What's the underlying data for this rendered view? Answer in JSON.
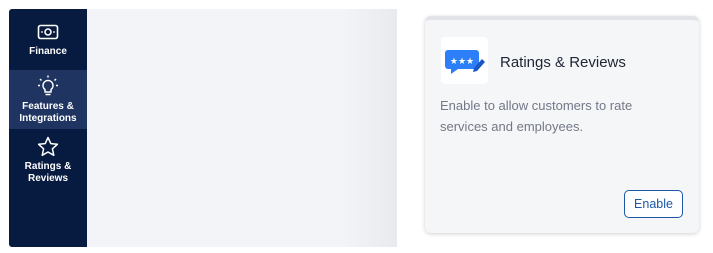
{
  "sidebar": {
    "items": [
      {
        "label": "Finance",
        "icon": "cash-icon",
        "active": false
      },
      {
        "label_line1": "Features &",
        "label_line2": "Integrations",
        "icon": "lightbulb-icon",
        "active": true
      },
      {
        "label_line1": "Ratings &",
        "label_line2": "Reviews",
        "icon": "star-icon",
        "active": false
      }
    ]
  },
  "card": {
    "title": "Ratings & Reviews",
    "icon": "ratings-chat-icon",
    "description": "Enable to allow customers to rate services and employees.",
    "enable_label": "Enable"
  },
  "colors": {
    "sidebar_bg": "#071a3f",
    "sidebar_active_bg": "#1f3460",
    "accent": "#1c57a8",
    "icon_blue": "#2d7ff9"
  }
}
